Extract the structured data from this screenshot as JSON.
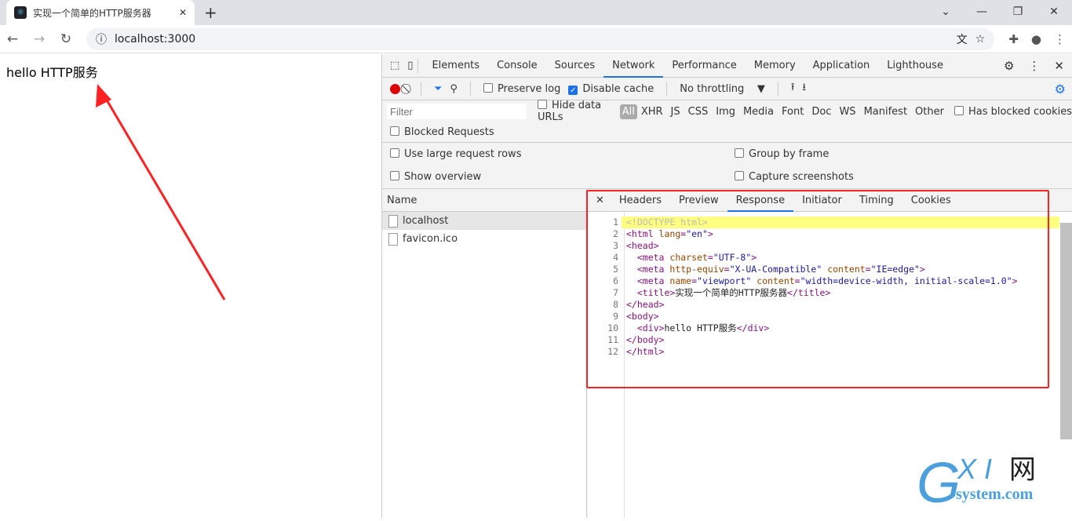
{
  "browser": {
    "tab_title": "实现一个简单的HTTP服务器",
    "url": "localhost:3000"
  },
  "page": {
    "text": "hello HTTP服务"
  },
  "devtools": {
    "tabs": [
      "Elements",
      "Console",
      "Sources",
      "Network",
      "Performance",
      "Memory",
      "Application",
      "Lighthouse"
    ],
    "active_tab": "Network",
    "toolbar": {
      "preserve_log": "Preserve log",
      "disable_cache": "Disable cache",
      "throttling": "No throttling"
    },
    "filter": {
      "placeholder": "Filter",
      "hide_data_urls": "Hide data URLs",
      "types": [
        "All",
        "XHR",
        "JS",
        "CSS",
        "Img",
        "Media",
        "Font",
        "Doc",
        "WS",
        "Manifest",
        "Other"
      ],
      "has_blocked_cookies": "Has blocked cookies",
      "blocked_requests": "Blocked Requests"
    },
    "settings": {
      "large_rows": "Use large request rows",
      "group_by_frame": "Group by frame",
      "show_overview": "Show overview",
      "capture_screenshots": "Capture screenshots"
    },
    "requests": {
      "header": "Name",
      "items": [
        "localhost",
        "favicon.ico"
      ]
    },
    "detail_tabs": [
      "Headers",
      "Preview",
      "Response",
      "Initiator",
      "Timing",
      "Cookies"
    ],
    "active_detail_tab": "Response",
    "response_lines": [
      [
        [
          "dc",
          "<!DOCTYPE html>"
        ]
      ],
      [
        [
          "tg",
          "<html "
        ],
        [
          "at",
          "lang"
        ],
        [
          "tg",
          "="
        ],
        [
          "vl",
          "\"en\""
        ],
        [
          "tg",
          ">"
        ]
      ],
      [
        [
          "tg",
          "<head>"
        ]
      ],
      [
        [
          "tg",
          "  <meta "
        ],
        [
          "at",
          "charset"
        ],
        [
          "tg",
          "="
        ],
        [
          "vl",
          "\"UTF-8\""
        ],
        [
          "tg",
          ">"
        ]
      ],
      [
        [
          "tg",
          "  <meta "
        ],
        [
          "at",
          "http-equiv"
        ],
        [
          "tg",
          "="
        ],
        [
          "vl",
          "\"X-UA-Compatible\""
        ],
        [
          "at",
          " content"
        ],
        [
          "tg",
          "="
        ],
        [
          "vl",
          "\"IE=edge\""
        ],
        [
          "tg",
          ">"
        ]
      ],
      [
        [
          "tg",
          "  <meta "
        ],
        [
          "at",
          "name"
        ],
        [
          "tg",
          "="
        ],
        [
          "vl",
          "\"viewport\""
        ],
        [
          "at",
          " content"
        ],
        [
          "tg",
          "="
        ],
        [
          "vl",
          "\"width=device-width, initial-scale=1.0\""
        ],
        [
          "tg",
          ">"
        ]
      ],
      [
        [
          "tg",
          "  <title>"
        ],
        [
          "tx",
          "实现一个简单的HTTP服务器"
        ],
        [
          "tg",
          "</title>"
        ]
      ],
      [
        [
          "tg",
          "</head>"
        ]
      ],
      [
        [
          "tg",
          "<body>"
        ]
      ],
      [
        [
          "tg",
          "  <div>"
        ],
        [
          "tx",
          "hello HTTP服务"
        ],
        [
          "tg",
          "</div>"
        ]
      ],
      [
        [
          "tg",
          "</body>"
        ]
      ],
      [
        [
          "tg",
          "</html>"
        ]
      ]
    ]
  },
  "watermark": {
    "text": "GXI网 system.com"
  }
}
